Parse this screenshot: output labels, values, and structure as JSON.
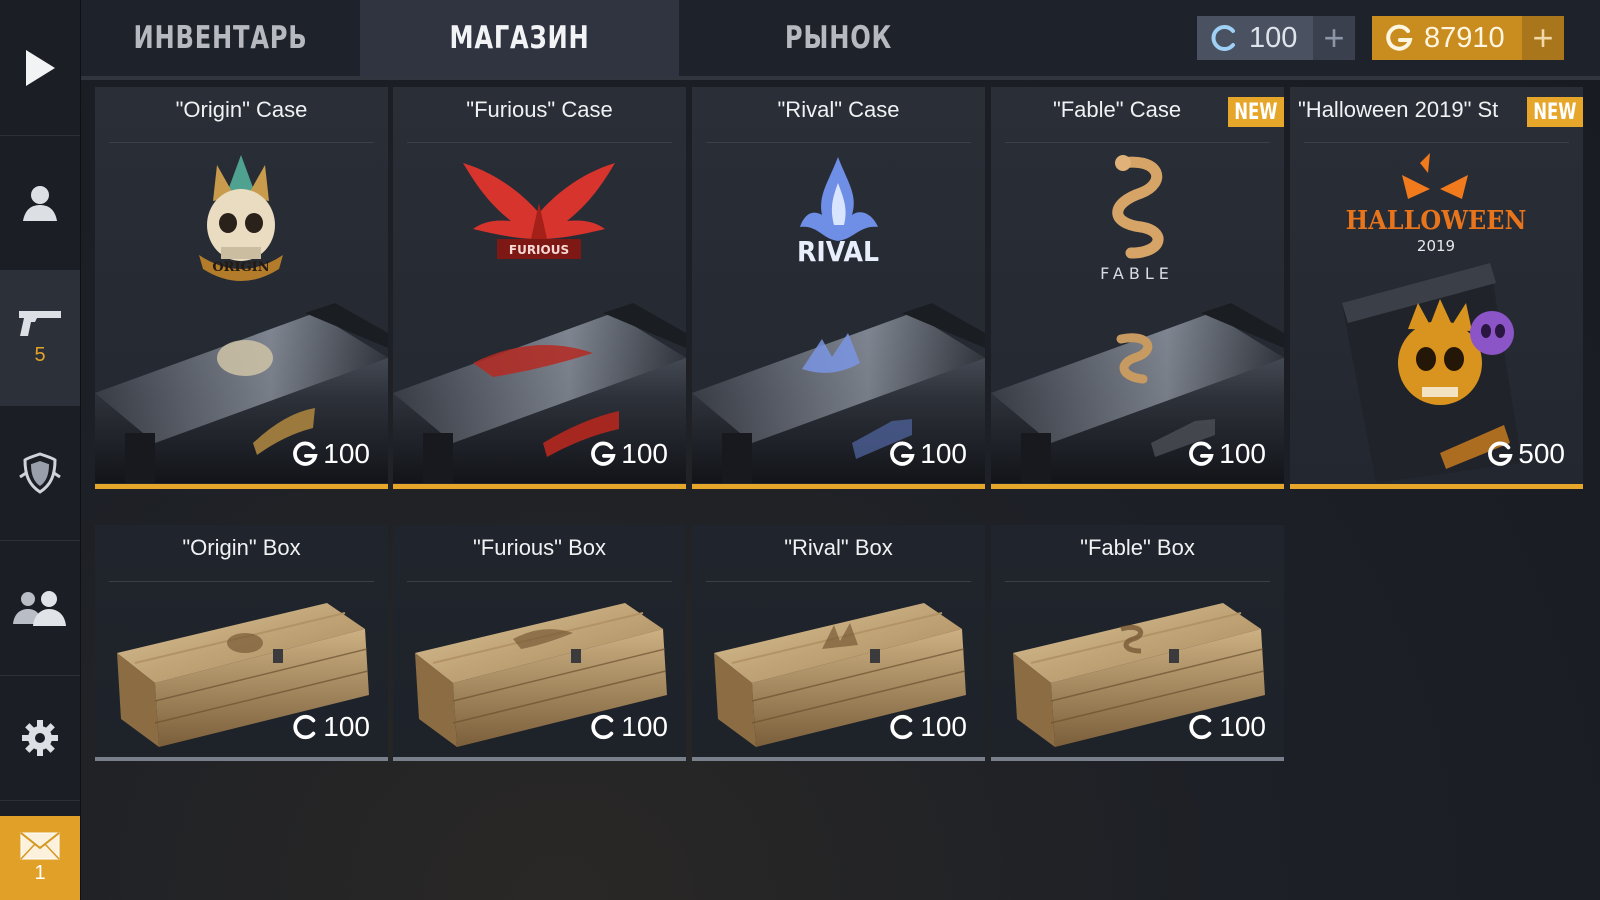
{
  "sidebar": {
    "items": [
      {
        "name": "play",
        "icon": "play-icon"
      },
      {
        "name": "profile",
        "icon": "user-icon"
      },
      {
        "name": "weapons",
        "icon": "pistol-icon",
        "count": "5"
      },
      {
        "name": "clan",
        "icon": "shield-icon"
      },
      {
        "name": "friends",
        "icon": "friends-icon"
      },
      {
        "name": "settings",
        "icon": "gear-icon"
      }
    ],
    "mail": {
      "icon": "envelope-icon",
      "count": "1"
    }
  },
  "tabs": [
    {
      "label": "ИНВЕНТАРЬ",
      "active": false
    },
    {
      "label": "МАГАЗИН",
      "active": true
    },
    {
      "label": "РЫНОК",
      "active": false
    }
  ],
  "currency": {
    "silver": {
      "value": "100",
      "plus": "+"
    },
    "gold": {
      "value": "87910",
      "plus": "+"
    }
  },
  "colors": {
    "accent": "#e6a629",
    "silver": "#4a5262",
    "background": "#1d2026"
  },
  "cases": [
    {
      "title": "\"Origin\" Case",
      "price": "100",
      "currency": "gold",
      "new": false,
      "logo": "ORIGIN"
    },
    {
      "title": "\"Furious\" Case",
      "price": "100",
      "currency": "gold",
      "new": false,
      "logo": "FURIOUS"
    },
    {
      "title": "\"Rival\" Case",
      "price": "100",
      "currency": "gold",
      "new": false,
      "logo": "RIVAL"
    },
    {
      "title": "\"Fable\" Case",
      "price": "100",
      "currency": "gold",
      "new": true,
      "badge": "NEW",
      "logo": "FABLE"
    },
    {
      "title": "\"Halloween 2019\" St",
      "price": "500",
      "currency": "gold",
      "new": true,
      "badge": "NEW",
      "logo": "HALLOWEEN",
      "year": "2019"
    }
  ],
  "boxes": [
    {
      "title": "\"Origin\" Box",
      "price": "100",
      "currency": "silver"
    },
    {
      "title": "\"Furious\" Box",
      "price": "100",
      "currency": "silver"
    },
    {
      "title": "\"Rival\" Box",
      "price": "100",
      "currency": "silver"
    },
    {
      "title": "\"Fable\" Box",
      "price": "100",
      "currency": "silver"
    }
  ]
}
